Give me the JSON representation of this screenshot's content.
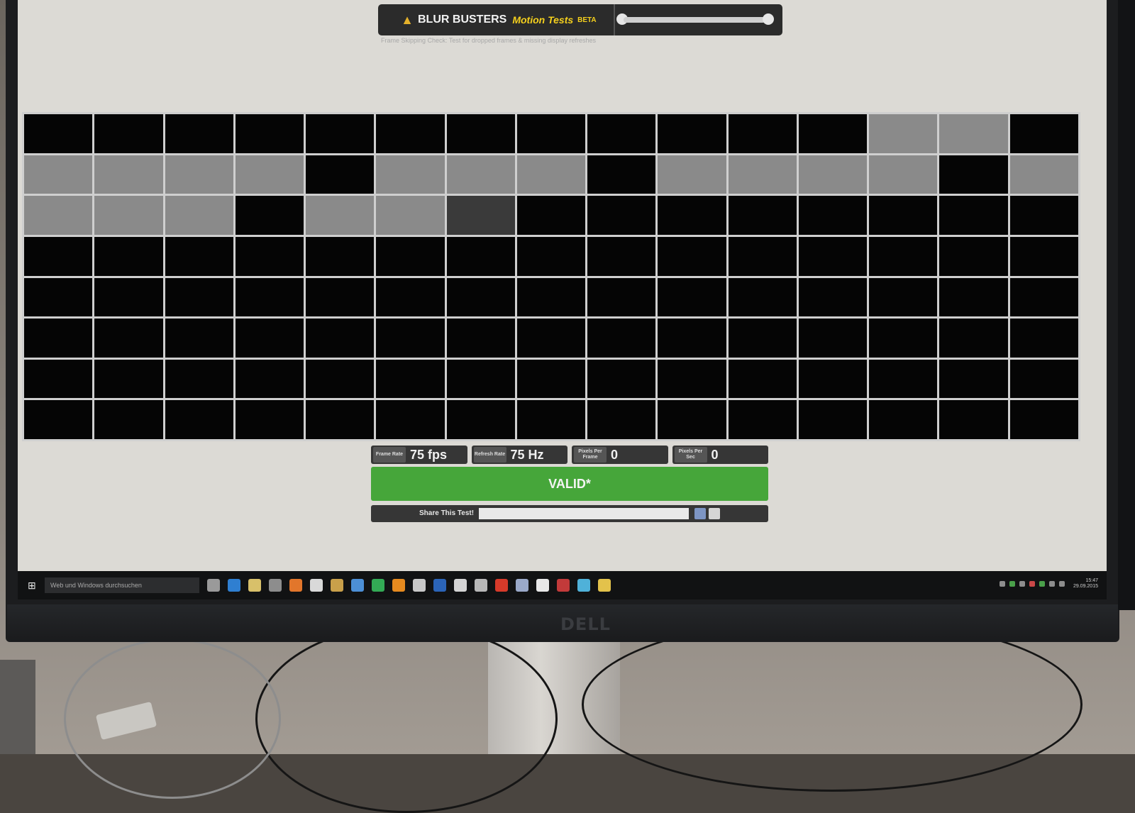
{
  "header": {
    "brand": "BLUR BUSTERS",
    "brand_sub": "Motion Tests",
    "badge": "BETA",
    "subtitle": "Frame Skipping Check: Test for dropped frames & missing display refreshes"
  },
  "grid_rows": [
    [
      0,
      0,
      0,
      0,
      0,
      0,
      0,
      0,
      0,
      0,
      0,
      0,
      1,
      1,
      0
    ],
    [
      1,
      1,
      1,
      1,
      0,
      1,
      1,
      1,
      0,
      1,
      1,
      1,
      1,
      0,
      1
    ],
    [
      1,
      1,
      1,
      0,
      1,
      1,
      2,
      0,
      0,
      0,
      0,
      0,
      0,
      0,
      0
    ],
    [
      0,
      0,
      0,
      0,
      0,
      0,
      0,
      0,
      0,
      0,
      0,
      0,
      0,
      0,
      0
    ],
    [
      0,
      0,
      0,
      0,
      0,
      0,
      0,
      0,
      0,
      0,
      0,
      0,
      0,
      0,
      0
    ],
    [
      0,
      0,
      0,
      0,
      0,
      0,
      0,
      0,
      0,
      0,
      0,
      0,
      0,
      0,
      0
    ],
    [
      0,
      0,
      0,
      0,
      0,
      0,
      0,
      0,
      0,
      0,
      0,
      0,
      0,
      0,
      0
    ],
    [
      0,
      0,
      0,
      0,
      0,
      0,
      0,
      0,
      0,
      0,
      0,
      0,
      0,
      0,
      0
    ]
  ],
  "stats": {
    "frame_rate_label": "Frame Rate",
    "frame_rate": "75 fps",
    "refresh_rate_label": "Refresh Rate",
    "refresh_rate": "75 Hz",
    "ppf_label": "Pixels Per Frame",
    "ppf": "0",
    "pps_label": "Pixels Per Sec",
    "pps": "0"
  },
  "status": {
    "label": "VALID*",
    "color": "#46a63a"
  },
  "share": {
    "label": "Share This Test!",
    "value": ""
  },
  "taskbar": {
    "search_placeholder": "Web und Windows durchsuchen",
    "clock_time": "15:47",
    "clock_date": "29.09.2015"
  },
  "monitor": {
    "brand": "DELL"
  },
  "icons": [
    "windows-start-icon",
    "task-view-icon",
    "edge-icon",
    "explorer-icon",
    "store-icon",
    "firefox-icon",
    "mail-icon",
    "app-icon",
    "twitter-icon",
    "spotify-icon",
    "vlc-icon",
    "settings-icon",
    "word-icon",
    "chat-icon",
    "notes-icon",
    "acrobat-icon",
    "docs-icon",
    "files-icon",
    "photoshop-icon",
    "chrome-icon",
    "app2-icon"
  ]
}
